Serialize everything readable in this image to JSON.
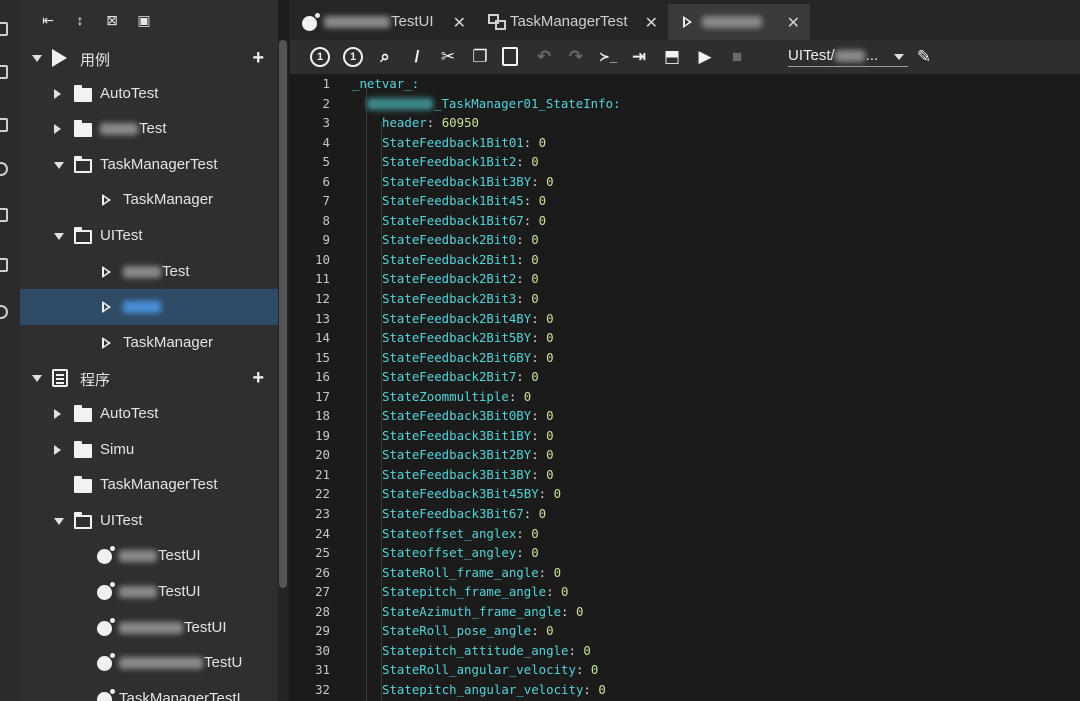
{
  "sidebar": {
    "toolbar": [
      {
        "icon": "collapse-left-icon"
      },
      {
        "icon": "expand-vertical-icon"
      },
      {
        "icon": "collapse-all-icon"
      },
      {
        "icon": "terminal-icon"
      }
    ],
    "tree": [
      {
        "label": "用例",
        "prefix": "",
        "depth": 0,
        "arrow": "down",
        "icon": "case-icon",
        "add": true
      },
      {
        "label": "AutoTest",
        "prefix": "",
        "depth": 1,
        "arrow": "right",
        "icon": "folder-icon"
      },
      {
        "label": "Test",
        "prefix": "blur",
        "depth": 1,
        "arrow": "right",
        "icon": "folder-icon"
      },
      {
        "label": "TaskManagerTest",
        "prefix": "",
        "depth": 1,
        "arrow": "down",
        "icon": "folder-open-icon"
      },
      {
        "label": "TaskManager",
        "prefix": "",
        "depth": 2,
        "arrow": "",
        "icon": "play-icon"
      },
      {
        "label": "UITest",
        "prefix": "",
        "depth": 1,
        "arrow": "down",
        "icon": "folder-open-icon"
      },
      {
        "label": "Test",
        "prefix": "blur",
        "depth": 2,
        "arrow": "",
        "icon": "play-icon"
      },
      {
        "label": "",
        "prefix": "blur",
        "depth": 2,
        "arrow": "",
        "icon": "play-icon",
        "selected": true
      },
      {
        "label": "TaskManager",
        "prefix": "",
        "depth": 2,
        "arrow": "",
        "icon": "play-icon"
      },
      {
        "label": "程序",
        "prefix": "",
        "depth": 0,
        "arrow": "down",
        "icon": "program-icon",
        "add": true
      },
      {
        "label": "AutoTest",
        "prefix": "",
        "depth": 1,
        "arrow": "right",
        "icon": "folder-icon"
      },
      {
        "label": "Simu",
        "prefix": "",
        "depth": 1,
        "arrow": "right",
        "icon": "folder-icon"
      },
      {
        "label": "TaskManagerTest",
        "prefix": "",
        "depth": 1,
        "arrow": "",
        "icon": "folder-icon"
      },
      {
        "label": "UITest",
        "prefix": "",
        "depth": 1,
        "arrow": "down",
        "icon": "folder-open-icon"
      },
      {
        "label": "TestUI",
        "prefix": "blur",
        "depth": 2,
        "arrow": "",
        "icon": "bulb-icon"
      },
      {
        "label": "TestUI",
        "prefix": "blur",
        "depth": 2,
        "arrow": "",
        "icon": "bulb-icon"
      },
      {
        "label": "TestUI",
        "prefix": "blur-long",
        "depth": 2,
        "arrow": "",
        "icon": "bulb-icon"
      },
      {
        "label": "TestU",
        "prefix": "blur-xlong",
        "depth": 2,
        "arrow": "",
        "icon": "bulb-icon"
      },
      {
        "label": "TaskManagerTestI",
        "prefix": "",
        "depth": 2,
        "arrow": "",
        "icon": "bulb-icon"
      }
    ]
  },
  "tabs": [
    {
      "label": "TestUI",
      "prefix": "blur",
      "icon": "bulb-icon",
      "close": "✕",
      "active": false
    },
    {
      "label": "TaskManagerTest",
      "prefix": "",
      "icon": "network-icon",
      "close": "✕",
      "active": false
    },
    {
      "label": "",
      "prefix": "blur",
      "icon": "play-icon",
      "close": "✕",
      "active": true
    }
  ],
  "editor_toolbar": {
    "buttons": [
      {
        "name": "step-one-button",
        "glyph": "1",
        "style": "circ",
        "disabled": false
      },
      {
        "name": "step-all-button",
        "glyph": "1",
        "style": "circ",
        "disabled": false
      },
      {
        "name": "search-doc-button",
        "glyph": "⌕",
        "style": "",
        "disabled": false
      },
      {
        "name": "comment-button",
        "glyph": "/",
        "style": "",
        "disabled": false
      },
      {
        "name": "cut-button",
        "glyph": "✂",
        "style": "",
        "disabled": false
      },
      {
        "name": "copy-button",
        "glyph": "❐",
        "style": "",
        "disabled": false
      },
      {
        "name": "paste-button",
        "glyph": "📋",
        "style": "",
        "disabled": false
      },
      {
        "name": "undo-button",
        "glyph": "↶",
        "style": "",
        "disabled": true
      },
      {
        "name": "redo-button",
        "glyph": "↷",
        "style": "",
        "disabled": true
      },
      {
        "name": "console-button",
        "glyph": "≻_",
        "style": "",
        "disabled": false
      },
      {
        "name": "export-button",
        "glyph": "⇥",
        "style": "",
        "disabled": false
      },
      {
        "name": "deploy-button",
        "glyph": "⬒",
        "style": "",
        "disabled": false
      },
      {
        "name": "run-button",
        "glyph": "▶",
        "style": "",
        "disabled": false
      },
      {
        "name": "stop-button",
        "glyph": "■",
        "style": "",
        "disabled": true
      }
    ],
    "target_select": "UITest/",
    "target_suffix": "...",
    "edit_glyph": "✎"
  },
  "code": {
    "lines": [
      {
        "n": "1",
        "indent": 0,
        "key": "_netvar_",
        "sep": ":",
        "value": ""
      },
      {
        "n": "2",
        "indent": 1,
        "key": "_TaskManager01_StateInfo",
        "sep": ":",
        "value": "",
        "blur_prefix": true
      },
      {
        "n": "3",
        "indent": 2,
        "key": "header",
        "sep": ": ",
        "value": "60950"
      },
      {
        "n": "4",
        "indent": 2,
        "key": "StateFeedback1Bit01",
        "sep": ": ",
        "value": "0"
      },
      {
        "n": "5",
        "indent": 2,
        "key": "StateFeedback1Bit2",
        "sep": ": ",
        "value": "0"
      },
      {
        "n": "6",
        "indent": 2,
        "key": "StateFeedback1Bit3BY",
        "sep": ": ",
        "value": "0"
      },
      {
        "n": "7",
        "indent": 2,
        "key": "StateFeedback1Bit45",
        "sep": ": ",
        "value": "0"
      },
      {
        "n": "8",
        "indent": 2,
        "key": "StateFeedback1Bit67",
        "sep": ": ",
        "value": "0"
      },
      {
        "n": "9",
        "indent": 2,
        "key": "StateFeedback2Bit0",
        "sep": ": ",
        "value": "0"
      },
      {
        "n": "10",
        "indent": 2,
        "key": "StateFeedback2Bit1",
        "sep": ": ",
        "value": "0"
      },
      {
        "n": "11",
        "indent": 2,
        "key": "StateFeedback2Bit2",
        "sep": ": ",
        "value": "0"
      },
      {
        "n": "12",
        "indent": 2,
        "key": "StateFeedback2Bit3",
        "sep": ": ",
        "value": "0"
      },
      {
        "n": "13",
        "indent": 2,
        "key": "StateFeedback2Bit4BY",
        "sep": ": ",
        "value": "0"
      },
      {
        "n": "14",
        "indent": 2,
        "key": "StateFeedback2Bit5BY",
        "sep": ": ",
        "value": "0"
      },
      {
        "n": "15",
        "indent": 2,
        "key": "StateFeedback2Bit6BY",
        "sep": ": ",
        "value": "0"
      },
      {
        "n": "16",
        "indent": 2,
        "key": "StateFeedback2Bit7",
        "sep": ": ",
        "value": "0"
      },
      {
        "n": "17",
        "indent": 2,
        "key": "StateZoommultiple",
        "sep": ": ",
        "value": "0"
      },
      {
        "n": "18",
        "indent": 2,
        "key": "StateFeedback3Bit0BY",
        "sep": ": ",
        "value": "0"
      },
      {
        "n": "19",
        "indent": 2,
        "key": "StateFeedback3Bit1BY",
        "sep": ": ",
        "value": "0"
      },
      {
        "n": "20",
        "indent": 2,
        "key": "StateFeedback3Bit2BY",
        "sep": ": ",
        "value": "0"
      },
      {
        "n": "21",
        "indent": 2,
        "key": "StateFeedback3Bit3BY",
        "sep": ": ",
        "value": "0"
      },
      {
        "n": "22",
        "indent": 2,
        "key": "StateFeedback3Bit45BY",
        "sep": ": ",
        "value": "0"
      },
      {
        "n": "23",
        "indent": 2,
        "key": "StateFeedback3Bit67",
        "sep": ": ",
        "value": "0"
      },
      {
        "n": "24",
        "indent": 2,
        "key": "Stateoffset_anglex",
        "sep": ": ",
        "value": "0"
      },
      {
        "n": "25",
        "indent": 2,
        "key": "Stateoffset_angley",
        "sep": ": ",
        "value": "0"
      },
      {
        "n": "26",
        "indent": 2,
        "key": "StateRoll_frame_angle",
        "sep": ": ",
        "value": "0"
      },
      {
        "n": "27",
        "indent": 2,
        "key": "Statepitch_frame_angle",
        "sep": ": ",
        "value": "0"
      },
      {
        "n": "28",
        "indent": 2,
        "key": "StateAzimuth_frame_angle",
        "sep": ": ",
        "value": "0"
      },
      {
        "n": "29",
        "indent": 2,
        "key": "StateRoll_pose_angle",
        "sep": ": ",
        "value": "0"
      },
      {
        "n": "30",
        "indent": 2,
        "key": "Statepitch_attitude_angle",
        "sep": ": ",
        "value": "0"
      },
      {
        "n": "31",
        "indent": 2,
        "key": "StateRoll_angular_velocity",
        "sep": ": ",
        "value": "0"
      },
      {
        "n": "32",
        "indent": 2,
        "key": "Statepitch_angular_velocity",
        "sep": ": ",
        "value": "0"
      }
    ]
  },
  "colors": {
    "key": "#55d3d9",
    "value": "#c9e29a",
    "selected_row": "#2f4b66"
  }
}
